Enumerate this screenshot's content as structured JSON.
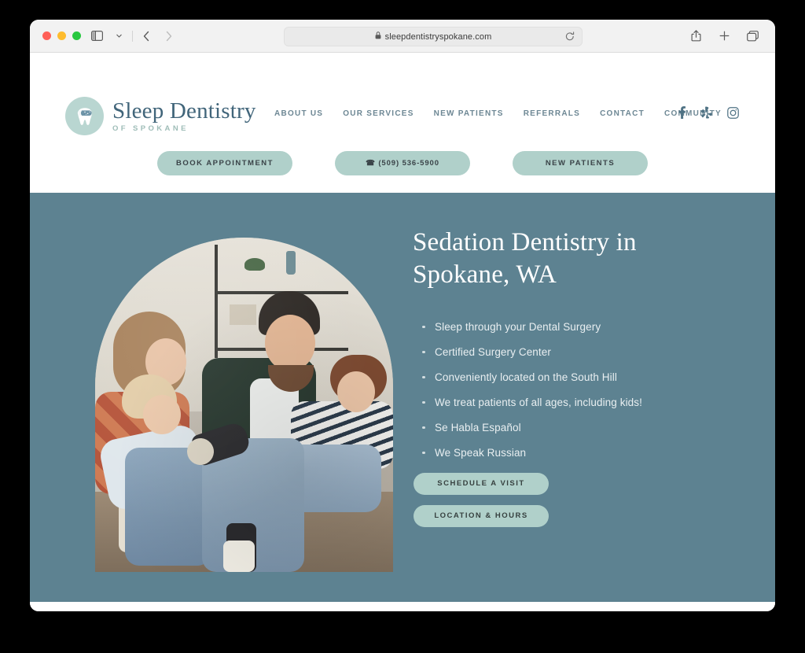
{
  "browser": {
    "url": "sleepdentistryspokane.com",
    "lock_icon": "lock-icon",
    "traffic_lights": [
      "close",
      "minimize",
      "maximize"
    ],
    "toolbar_icons": {
      "sidebar": "sidebar-icon",
      "tab_overview_chevron": "chevron-down-icon",
      "back": "back-arrow-icon",
      "forward": "forward-arrow-icon",
      "reload": "reload-icon",
      "share": "share-icon",
      "new_tab": "plus-icon",
      "tabs": "copy-tabs-icon"
    }
  },
  "site": {
    "logo": {
      "title": "Sleep Dentistry",
      "subtitle": "OF SPOKANE",
      "mark": "sleeping-tooth-icon"
    },
    "nav": [
      {
        "label": "ABOUT US"
      },
      {
        "label": "OUR SERVICES"
      },
      {
        "label": "NEW PATIENTS"
      },
      {
        "label": "REFERRALS"
      },
      {
        "label": "CONTACT"
      },
      {
        "label": "COMMUNITY"
      }
    ],
    "social": [
      {
        "name": "facebook-icon",
        "label": "f"
      },
      {
        "name": "yelp-icon",
        "label": "Yelp"
      },
      {
        "name": "instagram-icon",
        "label": "Instagram"
      }
    ],
    "cta_buttons": [
      {
        "label": "BOOK APPOINTMENT"
      },
      {
        "label": "☎ (509) 536-5900"
      },
      {
        "label": "NEW PATIENTS"
      }
    ]
  },
  "hero": {
    "title": "Sedation Dentistry in Spokane, WA",
    "image_alt": "Family with two children laughing together on a couch",
    "bullets": [
      "Sleep through your Dental Surgery",
      "Certified Surgery Center",
      "Conveniently located on the South Hill",
      "We treat patients of all ages, including kids!",
      "Se Habla Español",
      "We Speak Russian"
    ],
    "buttons": [
      {
        "label": "SCHEDULE A VISIT"
      },
      {
        "label": "LOCATION & HOURS"
      }
    ]
  },
  "colors": {
    "hero_background": "#5d8291",
    "button_mint": "#b0d0ca",
    "logo_blue": "#41657a",
    "nav_text": "#6d8794",
    "logo_circle": "#b9d6d1"
  }
}
